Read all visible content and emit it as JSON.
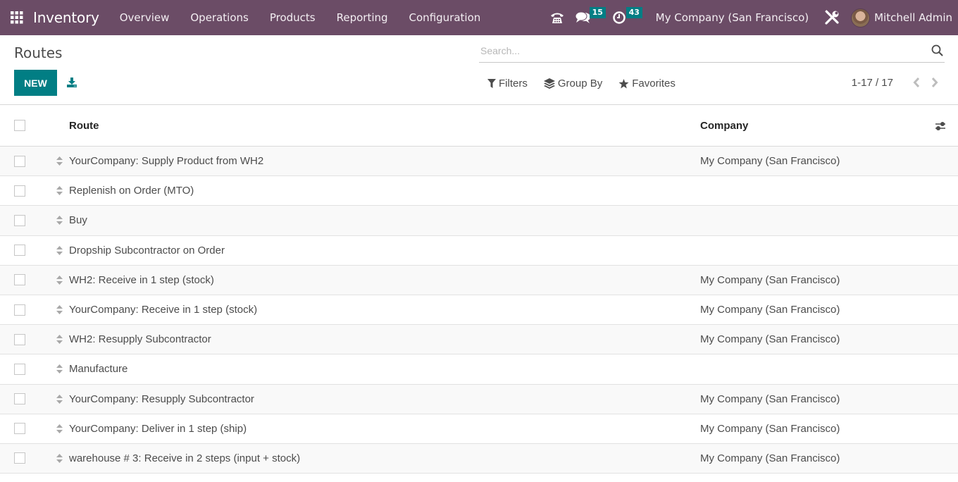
{
  "navbar": {
    "app_name": "Inventory",
    "menu": [
      "Overview",
      "Operations",
      "Products",
      "Reporting",
      "Configuration"
    ],
    "messages_count": "15",
    "activities_count": "43",
    "company": "My Company (San Francisco)",
    "user": "Mitchell Admin",
    "colors": {
      "background": "#6b4c66",
      "badge": "#017e84"
    }
  },
  "control_panel": {
    "title": "Routes",
    "new_label": "NEW",
    "search_placeholder": "Search...",
    "filters_label": "Filters",
    "groupby_label": "Group By",
    "favorites_label": "Favorites",
    "pager": "1-17 / 17",
    "accent": "#017e84"
  },
  "table": {
    "columns": [
      "Route",
      "Company"
    ],
    "rows": [
      {
        "route": "YourCompany: Supply Product from WH2",
        "company": "My Company (San Francisco)"
      },
      {
        "route": "Replenish on Order (MTO)",
        "company": ""
      },
      {
        "route": "Buy",
        "company": ""
      },
      {
        "route": "Dropship Subcontractor on Order",
        "company": ""
      },
      {
        "route": "WH2: Receive in 1 step (stock)",
        "company": "My Company (San Francisco)"
      },
      {
        "route": "YourCompany: Receive in 1 step (stock)",
        "company": "My Company (San Francisco)"
      },
      {
        "route": "WH2: Resupply Subcontractor",
        "company": "My Company (San Francisco)"
      },
      {
        "route": "Manufacture",
        "company": ""
      },
      {
        "route": "YourCompany: Resupply Subcontractor",
        "company": "My Company (San Francisco)"
      },
      {
        "route": "YourCompany: Deliver in 1 step (ship)",
        "company": "My Company (San Francisco)"
      },
      {
        "route": "warehouse # 3: Receive in 2 steps (input + stock)",
        "company": "My Company (San Francisco)"
      }
    ]
  }
}
